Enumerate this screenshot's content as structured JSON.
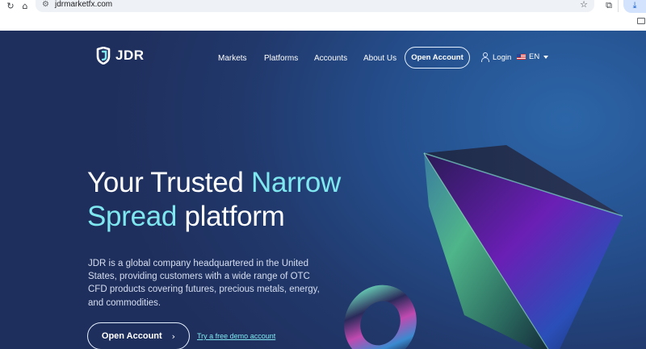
{
  "browser": {
    "url": "jdrmarketfx.com",
    "icons": [
      "reload-icon",
      "home-icon",
      "site-settings-icon",
      "bookmark-star-icon",
      "extensions-icon",
      "download-icon",
      "bookmarks-folder-icon"
    ]
  },
  "header": {
    "logo_text": "JDR",
    "nav": [
      "Markets",
      "Platforms",
      "Accounts",
      "About Us"
    ],
    "open_account": "Open Account",
    "login": "Login",
    "language": "EN"
  },
  "hero": {
    "headline_part1": "Your Trusted ",
    "headline_accent1": "Narrow",
    "headline_accent2": "Spread",
    "headline_part2": " platform",
    "description": "JDR is a global company headquartered in the United States, providing customers with a wide range of OTC CFD products covering futures, precious metals, energy, and commodities.",
    "cta": "Open Account",
    "demo_link": "Try a free demo account"
  },
  "colors": {
    "accent": "#7fe7ef",
    "background_dark": "#1f2f5d",
    "background_light": "#2c66a8"
  }
}
